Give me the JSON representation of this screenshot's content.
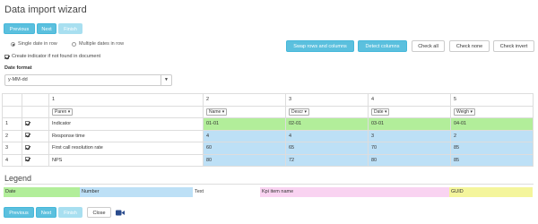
{
  "title": "Data import wizard",
  "top_buttons": {
    "previous": "Previous",
    "next": "Next",
    "finish": "Finish"
  },
  "options": {
    "single_date": "Single date in row",
    "multiple_dates": "Multiple dates in row",
    "create_indicator": "Create indicator if not found in document"
  },
  "actions": {
    "swap": "Swap rows and columns",
    "detect": "Detect columns",
    "check_all": "Check all",
    "check_none": "Check none",
    "check_invert": "Check invert"
  },
  "date_format": {
    "label": "Date format",
    "value": "y-MM-dd"
  },
  "table": {
    "col_numbers": [
      "1",
      "2",
      "3",
      "4",
      "5"
    ],
    "types": [
      "Paren",
      "Name",
      "Descr",
      "Date",
      "Weigh"
    ],
    "rows": [
      {
        "num": "1",
        "checked": true,
        "cells": [
          "Indicator",
          "01-01",
          "02-01",
          "03-01",
          "04-01"
        ]
      },
      {
        "num": "2",
        "checked": true,
        "cells": [
          "Response time",
          "4",
          "4",
          "3",
          "2"
        ]
      },
      {
        "num": "3",
        "checked": true,
        "cells": [
          "First call resolution rate",
          "60",
          "65",
          "70",
          "85"
        ]
      },
      {
        "num": "4",
        "checked": true,
        "cells": [
          "NPS",
          "80",
          "72",
          "80",
          "85"
        ]
      }
    ]
  },
  "legend": {
    "title": "Legend",
    "items": [
      {
        "label": "Date",
        "color": "#b2ee9a"
      },
      {
        "label": "Number",
        "color": "#bde0f6"
      },
      {
        "label": "Text",
        "color": "#ffffff"
      },
      {
        "label": "Kpi item name",
        "color": "#f9d3f1"
      },
      {
        "label": "GUID",
        "color": "#f4f59c"
      }
    ]
  },
  "bottom_buttons": {
    "previous": "Previous",
    "next": "Next",
    "finish": "Finish",
    "close": "Close",
    "video_icon": "video-camera-icon"
  },
  "colors": {
    "accent": "#5bc0de",
    "date": "#b2ee9a",
    "number": "#bde0f6"
  }
}
